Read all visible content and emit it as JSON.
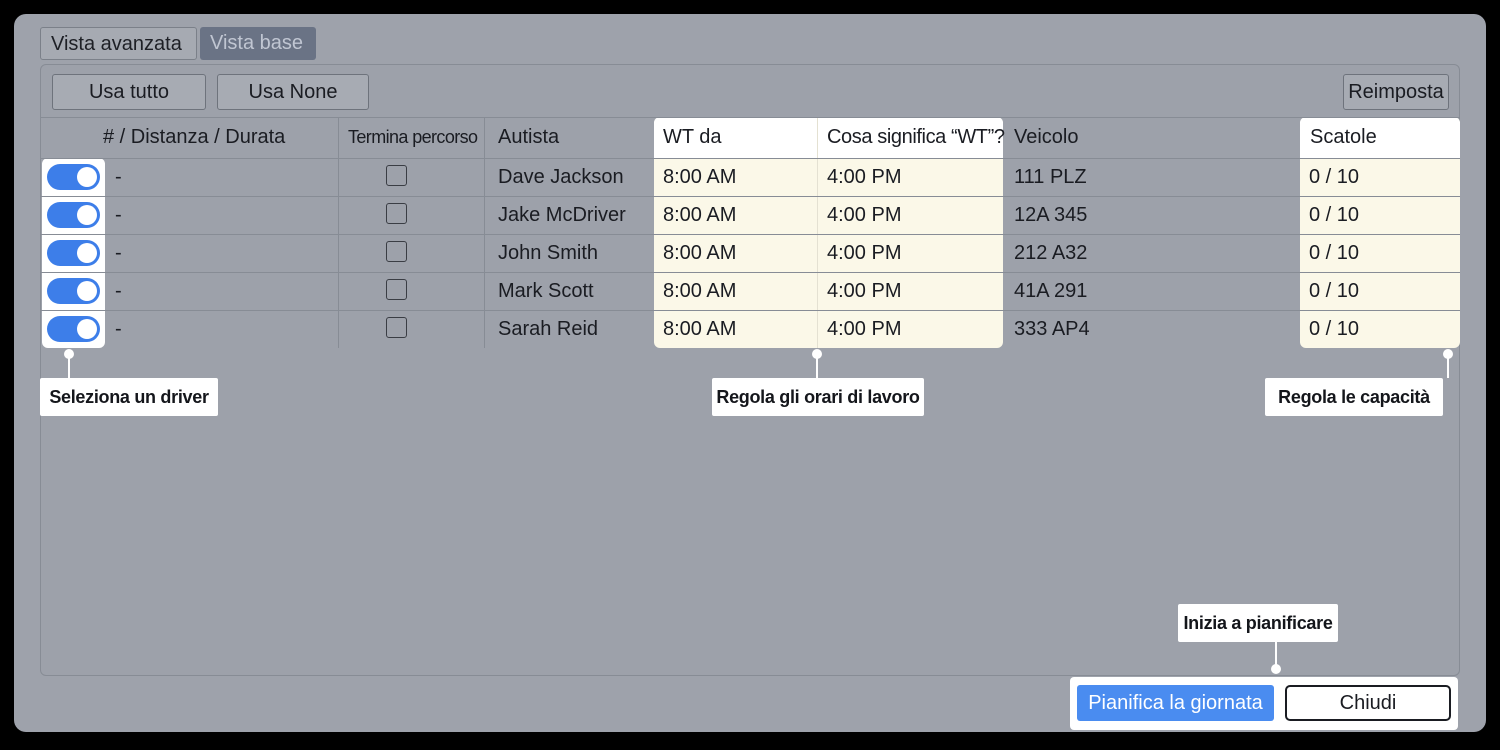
{
  "tabs": [
    {
      "label": "Vista avanzata",
      "active": false
    },
    {
      "label": "Vista base",
      "active": true
    }
  ],
  "toolbar": {
    "use_all": "Usa tutto",
    "use_none": "Usa None",
    "reset": "Reimposta"
  },
  "columns": {
    "distance": "# / Distanza / Durata",
    "end_route": "Termina percorso",
    "driver": "Autista",
    "wt_from": "WT da",
    "wt_meaning": "Cosa significa “WT”?",
    "vehicle": "Veicolo",
    "boxes": "Scatole"
  },
  "rows": [
    {
      "enabled": true,
      "distance": "-",
      "end_route": false,
      "driver": "Dave Jackson",
      "wt_from": "8:00 AM",
      "wt_to": "4:00 PM",
      "vehicle": "111 PLZ",
      "boxes": "0 / 10"
    },
    {
      "enabled": true,
      "distance": "-",
      "end_route": false,
      "driver": "Jake McDriver",
      "wt_from": "8:00 AM",
      "wt_to": "4:00 PM",
      "vehicle": "12A 345",
      "boxes": "0 / 10"
    },
    {
      "enabled": true,
      "distance": "-",
      "end_route": false,
      "driver": "John Smith",
      "wt_from": "8:00 AM",
      "wt_to": "4:00 PM",
      "vehicle": "212 A32",
      "boxes": "0 / 10"
    },
    {
      "enabled": true,
      "distance": "-",
      "end_route": false,
      "driver": "Mark Scott",
      "wt_from": "8:00 AM",
      "wt_to": "4:00 PM",
      "vehicle": "41A 291",
      "boxes": "0 / 10"
    },
    {
      "enabled": true,
      "distance": "-",
      "end_route": false,
      "driver": "Sarah Reid",
      "wt_from": "8:00 AM",
      "wt_to": "4:00 PM",
      "vehicle": "333 AP4",
      "boxes": "0 / 10"
    }
  ],
  "callouts": {
    "select_driver": "Seleziona un driver",
    "work_hours": "Regola gli orari di lavoro",
    "capacity": "Regola le capacità",
    "start_planning": "Inizia a pianificare"
  },
  "footer": {
    "plan_day": "Pianifica la giornata",
    "close": "Chiudi"
  },
  "colors": {
    "accent": "#3d7ee9",
    "primary_button": "#4a8cf0",
    "highlight": "#fbf8e8",
    "dialog_bg": "#9ea2ab"
  }
}
